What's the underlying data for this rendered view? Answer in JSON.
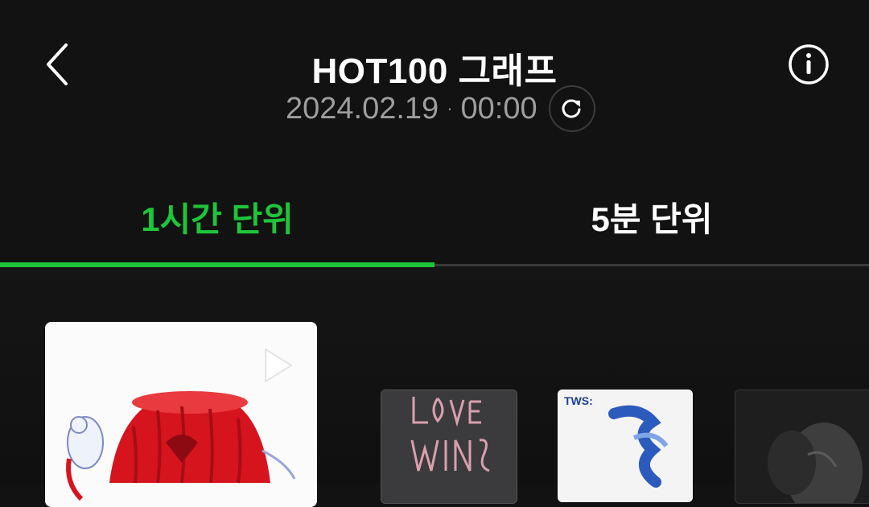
{
  "header": {
    "title": "HOT100 그래프",
    "date": "2024.02.19",
    "separator": "·",
    "time": "00:00"
  },
  "icons": {
    "back": "chevron-left-icon",
    "refresh": "refresh-icon",
    "info": "info-icon",
    "play": "play-icon"
  },
  "tabs": [
    {
      "label": "1시간 단위",
      "active": true
    },
    {
      "label": "5분 단위",
      "active": false
    }
  ],
  "colors": {
    "accent": "#1ec53a",
    "background": "#121212",
    "subtitle": "#9e9e9e"
  },
  "albums": {
    "thumb2_label": "TWS:"
  }
}
